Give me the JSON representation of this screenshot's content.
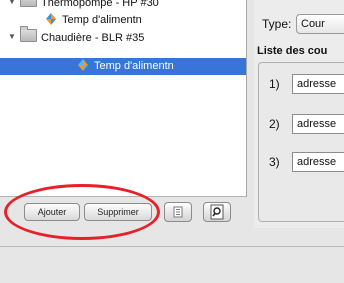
{
  "tree": {
    "items": [
      {
        "label": "Thermopompe - HP #30",
        "icon": "folder-icon",
        "expanded": true
      },
      {
        "label": "Temp d'alimentn",
        "icon": "sensor-icon"
      },
      {
        "label": "Chaudière - BLR #35",
        "icon": "folder-icon",
        "expanded": true
      },
      {
        "label": "Temp d'alimentn",
        "icon": "sensor-icon",
        "selected": true
      }
    ]
  },
  "buttons": {
    "add_label": "Ajouter",
    "delete_label": "Supprimer",
    "list_view_icon": "list-icon",
    "search_icon": "magnifier-icon"
  },
  "right": {
    "type_label": "Type:",
    "type_value": "Cour",
    "list_title": "Liste des cou",
    "rows": [
      {
        "num": "1)",
        "value": "adresse"
      },
      {
        "num": "2)",
        "value": "adresse"
      },
      {
        "num": "3)",
        "value": "adresse"
      }
    ]
  },
  "colors": {
    "selection": "#3875d7",
    "annotation": "#e8202a"
  }
}
